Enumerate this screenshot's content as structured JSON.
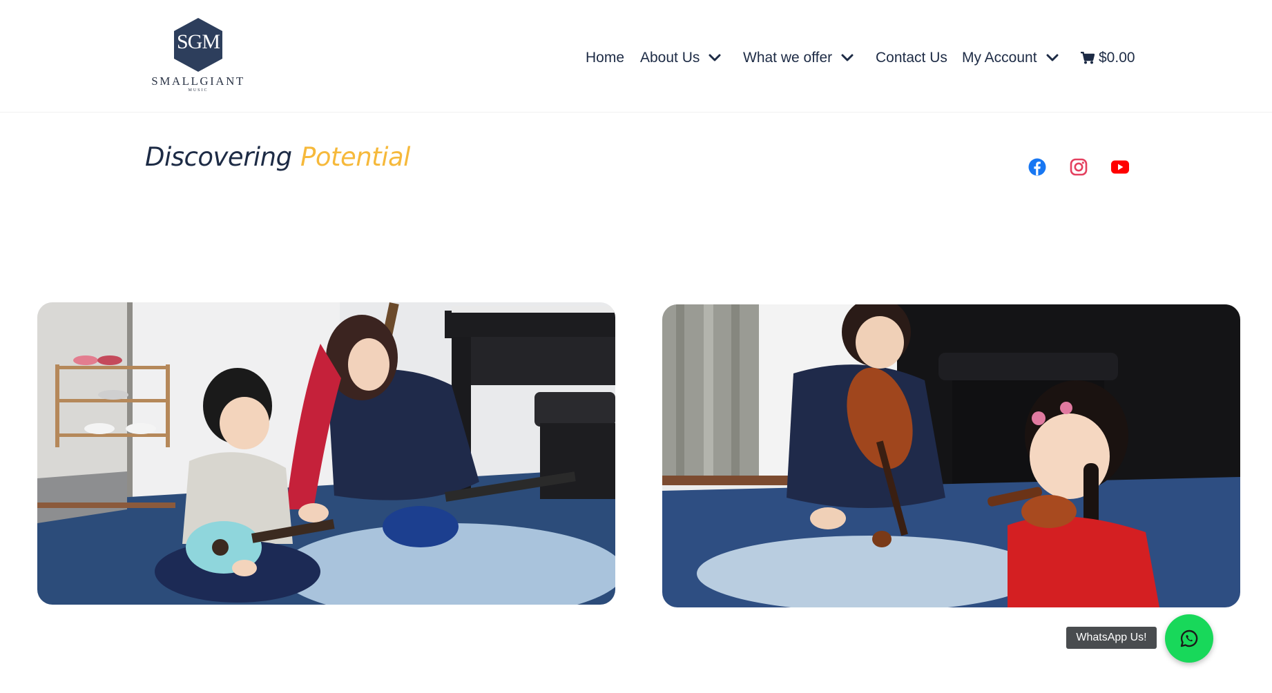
{
  "brand": {
    "initials": "SGM",
    "name": "SMALLGIANT",
    "sub": "MUSIC"
  },
  "nav": {
    "items": [
      {
        "label": "Home",
        "has_dropdown": false
      },
      {
        "label": "About Us",
        "has_dropdown": true
      },
      {
        "label": "What we offer",
        "has_dropdown": true
      },
      {
        "label": "Contact Us",
        "has_dropdown": false
      },
      {
        "label": "My Account",
        "has_dropdown": true
      }
    ],
    "cart_total": "$0.00",
    "cart_icon": "shopping-cart-icon"
  },
  "tagline": {
    "part1": "Discovering",
    "part2": "Potential"
  },
  "social": [
    {
      "name": "facebook-icon",
      "color": "#1877f2"
    },
    {
      "name": "instagram-icon",
      "color": "#e4405f"
    },
    {
      "name": "youtube-icon",
      "color": "#ff0000"
    }
  ],
  "colors": {
    "navy": "#1d2b45",
    "accent": "#f6b93b",
    "whatsapp": "#18d85a"
  },
  "whatsapp": {
    "label": "WhatsApp Us!",
    "icon": "whatsapp-icon"
  }
}
